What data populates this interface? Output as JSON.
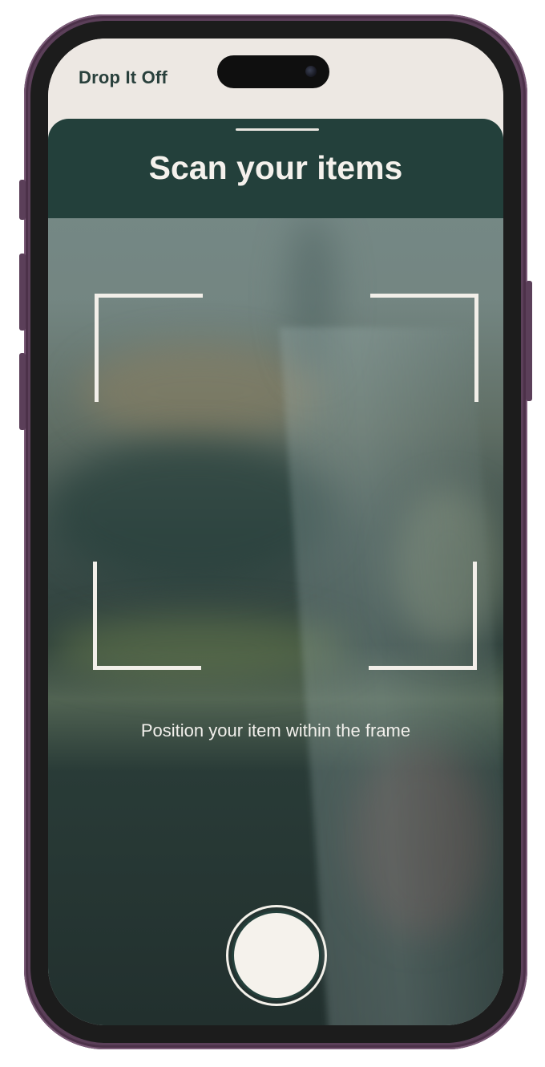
{
  "app": {
    "name": "Drop It Off"
  },
  "scan": {
    "title": "Scan your items",
    "instruction": "Position your item within the frame"
  },
  "colors": {
    "header_bg": "#23403b",
    "status_bg": "#ede8e3",
    "app_name_color": "#29403c",
    "frame_color": "#f2efe9",
    "phone_frame": "#5b3f59"
  },
  "icons": {
    "shutter": "capture-button-icon",
    "front_camera": "front-camera-icon"
  }
}
